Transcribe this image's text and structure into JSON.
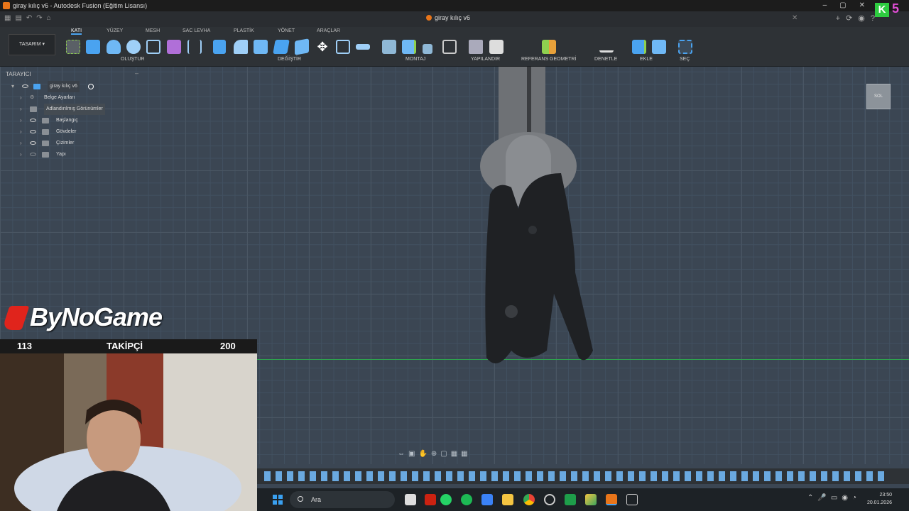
{
  "title_bar": {
    "text": "giray kılıç v6 - Autodesk Fusion (Eğitim Lisansı)"
  },
  "doc_tab": {
    "title": "giray kılıç v6"
  },
  "workspace": {
    "label": "TASARIM"
  },
  "ribbon_tabs": [
    "KATI",
    "YÜZEY",
    "MESH",
    "SAC LEVHA",
    "PLASTİK",
    "YÖNET",
    "ARAÇLAR"
  ],
  "ribbon_groups": [
    "OLUŞTUR",
    "DEĞİŞTİR",
    "MONTAJ",
    "YAPILANDIR",
    "REFERANS GEOMETRİ",
    "DENETLE",
    "EKLE",
    "SEÇ"
  ],
  "browser": {
    "title": "TARAYICI",
    "root": "giray kılıç v6",
    "items": [
      "Belge Ayarları",
      "Adlandırılmış Görünümler",
      "Başlangıç",
      "Gövdeler",
      "Çizimler",
      "Yapı"
    ]
  },
  "viewcube": {
    "face": "SOL"
  },
  "stream": {
    "brand": "ByNoGame",
    "follower_current": "113",
    "follower_label": "TAKİPÇİ",
    "follower_goal": "200"
  },
  "taskbar": {
    "search_placeholder": "Ara",
    "time": "23:50",
    "date": "20.01.2026"
  },
  "colors": {
    "accent": "#4aa3f0",
    "axis_green": "#2da44e",
    "fusion_orange": "#e8751a",
    "brand_red": "#e0241c"
  }
}
